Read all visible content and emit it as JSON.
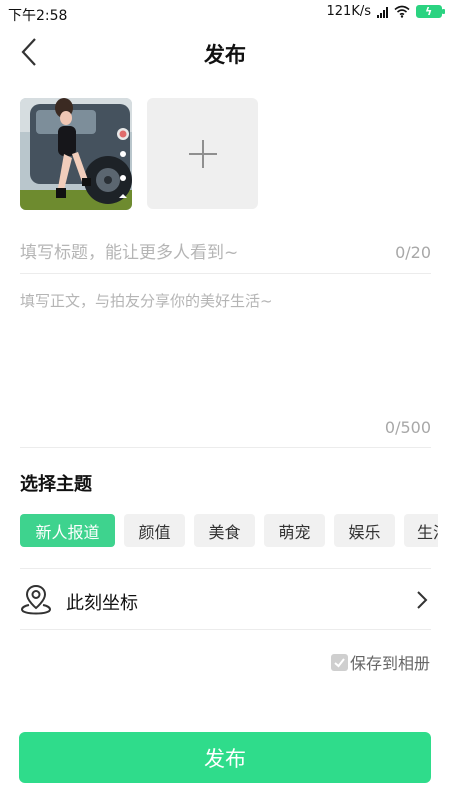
{
  "status_bar": {
    "time": "下午2:58",
    "speed": "121K/s",
    "icons": [
      "signal-icon",
      "wifi-icon",
      "battery-charging-icon"
    ]
  },
  "header": {
    "title": "发布",
    "back_icon": "back-arrow-icon"
  },
  "media": {
    "add_icon": "plus-icon"
  },
  "title_field": {
    "placeholder": "填写标题，能让更多人看到~",
    "value": "",
    "counter": "0/20"
  },
  "body_field": {
    "placeholder": "填写正文，与拍友分享你的美好生活~",
    "value": "",
    "counter": "0/500"
  },
  "topics": {
    "title": "选择主题",
    "chips": [
      "新人报道",
      "颜值",
      "美食",
      "萌宠",
      "娱乐",
      "生活"
    ],
    "selected": "新人报道"
  },
  "location": {
    "label": "此刻坐标",
    "icon": "location-pin-icon",
    "chevron": "chevron-right-icon"
  },
  "save_to_album": {
    "label": "保存到相册",
    "checked": true
  },
  "publish_button": {
    "label": "发布"
  },
  "colors": {
    "accent": "#2fdc8b",
    "chip_active": "#3ed38e",
    "chip_bg": "#f1f1f1",
    "placeholder": "#b5b5b5"
  }
}
